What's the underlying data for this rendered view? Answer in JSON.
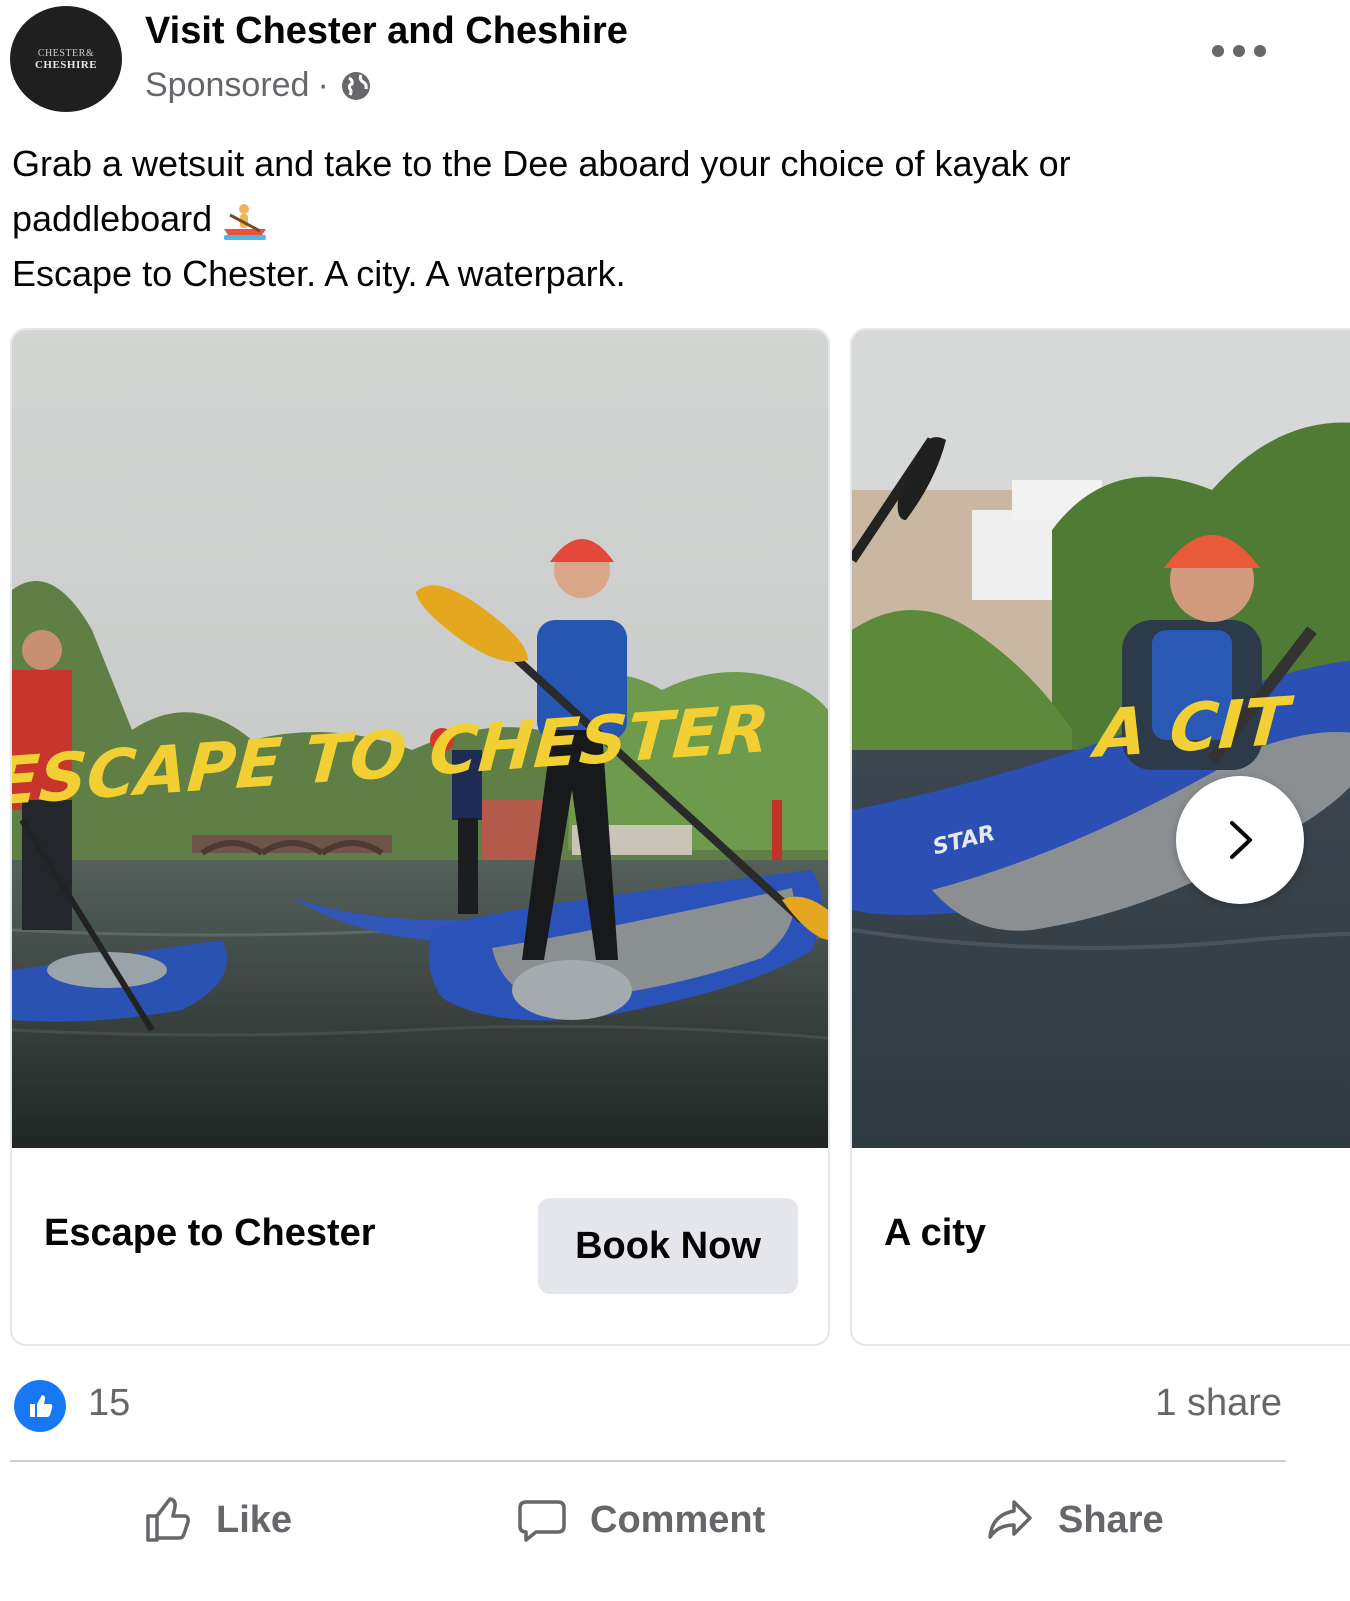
{
  "post": {
    "page_name": "Visit Chester and Cheshire",
    "avatar_text_line1": "CHESTER&",
    "avatar_text_line2": "CHESHIRE",
    "sponsored": "Sponsored",
    "separator": "·",
    "globe_icon": "globe-icon",
    "more_icon": "more-options-icon",
    "text_line1": "Grab a wetsuit and take to the Dee aboard your choice of kayak or",
    "text_line2": "paddleboard",
    "text_line2_emoji": "rowboat-emoji",
    "text_line3": "Escape to Chester. A city. A waterpark."
  },
  "carousel": {
    "cards": [
      {
        "overlay_text": "ESCAPE TO CHESTER",
        "title": "Escape to Chester",
        "cta": "Book Now"
      },
      {
        "overlay_text": "A CIT",
        "title": "A city",
        "kayak_brand": "STAR"
      }
    ],
    "next_icon": "chevron-right-icon"
  },
  "reactions": {
    "like_count": "15",
    "share_count": "1 share"
  },
  "actions": {
    "like": "Like",
    "comment": "Comment",
    "share": "Share"
  },
  "colors": {
    "facebook_blue": "#1877f2",
    "secondary_text": "#65676b",
    "button_gray": "#e4e6eb",
    "overlay_yellow": "#f2d033"
  }
}
